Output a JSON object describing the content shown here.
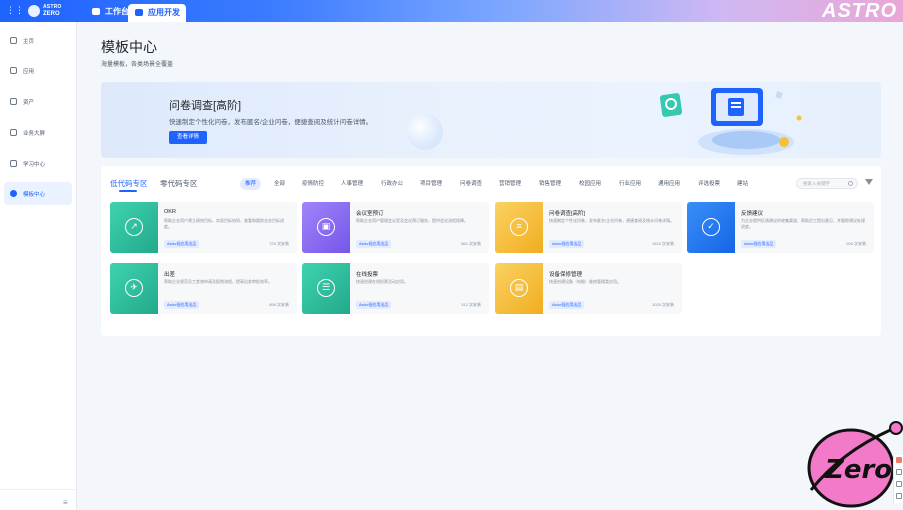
{
  "topbar": {
    "logo_line1": "ASTRO",
    "logo_line2": "ZERO",
    "tabs": [
      {
        "label": "工作台",
        "active": false
      },
      {
        "label": "应用开发",
        "active": true
      }
    ],
    "brand": "ASTRO"
  },
  "sidebar": {
    "items": [
      {
        "label": "主页",
        "icon": "home-icon",
        "active": false
      },
      {
        "label": "应用",
        "icon": "app-icon",
        "active": false
      },
      {
        "label": "资产",
        "icon": "asset-icon",
        "active": false
      },
      {
        "label": "业务大屏",
        "icon": "dashboard-icon",
        "active": false
      },
      {
        "label": "学习中心",
        "icon": "learning-icon",
        "active": false
      },
      {
        "label": "模板中心",
        "icon": "template-icon",
        "active": true
      }
    ],
    "collapse_icon": "≡"
  },
  "page": {
    "title": "模板中心",
    "subtitle": "海量模板，各类场景全覆盖"
  },
  "banner": {
    "title": "问卷调查[高阶]",
    "description": "快速制定个性化问卷，发布匿名/企业问卷，便捷查阅及统计问卷详情。",
    "button": "查看详情"
  },
  "panel": {
    "tabs": [
      {
        "label": "低代码专区",
        "active": true
      },
      {
        "label": "零代码专区",
        "active": false
      }
    ],
    "categories": [
      "推荐",
      "全部",
      "疫情防控",
      "人事管理",
      "行政办公",
      "项目管理",
      "问卷调查",
      "营销管理",
      "销售管理",
      "校园应用",
      "行业应用",
      "通用应用",
      "评选投票",
      "建站"
    ],
    "active_category": "推荐",
    "search_placeholder": "搜索入关键字",
    "cards": [
      {
        "title": "OKR",
        "desc": "帮助企业用户建立绩效目标，实现目标协同，查看和跟踪业务目标进度。",
        "tag": "Astro低应用出品",
        "count": "729 次安装",
        "color": "#2ec4a0",
        "icon": "chart-icon"
      },
      {
        "title": "会议室预订",
        "desc": "帮助企业用户管理会议室及会议预订服务，提供会议流程保障。",
        "tag": "Astro低应用出品",
        "count": "860 次安装",
        "color": "#8b6cf5",
        "icon": "presentation-icon"
      },
      {
        "title": "问卷调查[高阶]",
        "desc": "快速制定个性化问卷，发布匿名/企业问卷，便捷查阅及统计问卷详情。",
        "tag": "Astro低应用出品",
        "count": "1615 次安装",
        "color": "#f5c13b",
        "icon": "clipboard-icon"
      },
      {
        "title": "反馈建议",
        "desc": "为企业提供反馈建议的收集渠道，帮助员工提出意见，并跟踪建议处理进度。",
        "tag": "Astro低应用出品",
        "count": "206 次安装",
        "color": "#1f7bf2",
        "icon": "feedback-icon"
      },
      {
        "title": "出差",
        "desc": "帮助企业规范员工差旅申请及报销流程，提高出差审批效率。",
        "tag": "Astro低应用出品",
        "count": "898 次安装",
        "color": "#2ec4a0",
        "icon": "plane-icon"
      },
      {
        "title": "在线投票",
        "desc": "快速创建在线投票活动应用。",
        "tag": "Astro低应用出品",
        "count": "312 次安装",
        "color": "#2ec4a0",
        "icon": "vote-icon"
      },
      {
        "title": "设备保修管理",
        "desc": "快速创建设备（电脑）维修管理类应用。",
        "tag": "Astro低应用出品",
        "count": "1025 次安装",
        "color": "#f5c13b",
        "icon": "device-icon"
      }
    ]
  }
}
